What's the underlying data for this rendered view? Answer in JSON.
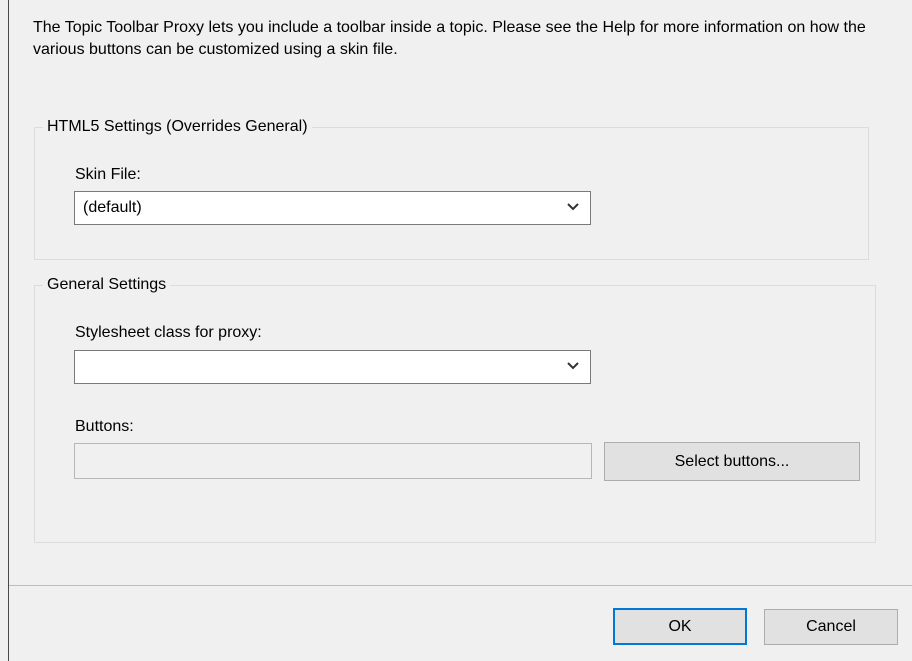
{
  "intro": {
    "text": "The Topic Toolbar Proxy lets you include a toolbar inside a topic.  Please see the Help for more information on how the various buttons can be customized using a skin file."
  },
  "html5_settings": {
    "legend": "HTML5 Settings (Overrides General)",
    "skin_file_label": "Skin File:",
    "skin_file_value": "(default)"
  },
  "general_settings": {
    "legend": "General Settings",
    "stylesheet_label": "Stylesheet class for proxy:",
    "stylesheet_value": "",
    "buttons_label": "Buttons:",
    "buttons_value": "",
    "select_buttons_label": "Select buttons..."
  },
  "footer": {
    "ok_label": "OK",
    "cancel_label": "Cancel"
  },
  "icons": {
    "dropdown": "chevron-down-icon"
  }
}
